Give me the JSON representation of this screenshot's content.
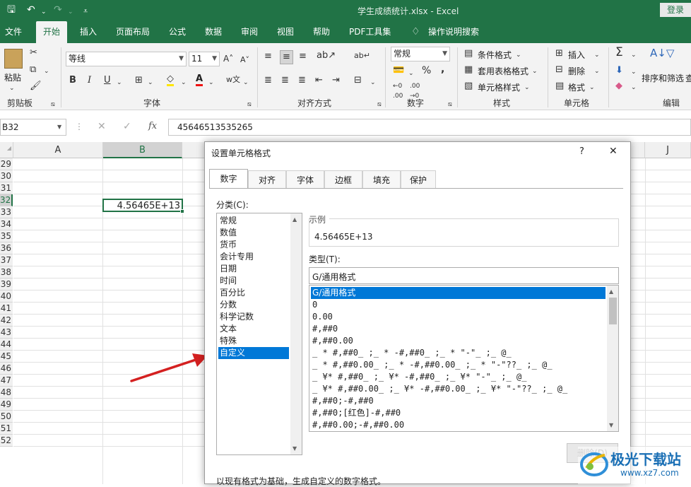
{
  "titlebar": {
    "doc_title": "学生成绩统计.xlsx  -  Excel",
    "login": "登录"
  },
  "tabs": [
    "文件",
    "开始",
    "插入",
    "页面布局",
    "公式",
    "数据",
    "审阅",
    "视图",
    "帮助",
    "PDF工具集",
    "操作说明搜索"
  ],
  "ribbon": {
    "clipboard": {
      "paste": "粘贴",
      "label": "剪贴板"
    },
    "font": {
      "name": "等线",
      "size": "11",
      "label": "字体",
      "bold": "B",
      "italic": "I",
      "underline": "U"
    },
    "align": {
      "label": "对齐方式"
    },
    "number": {
      "format": "常规",
      "label": "数字",
      "percent": "%",
      "comma": ","
    },
    "styles": {
      "conditional": "条件格式",
      "table": "套用表格格式",
      "cell": "单元格样式",
      "label": "样式"
    },
    "cells": {
      "insert": "插入",
      "delete": "删除",
      "format": "格式",
      "label": "单元格"
    },
    "edit": {
      "sort": "排序和筛选",
      "find": "查",
      "label": "编辑"
    }
  },
  "formula_bar": {
    "name_box": "B32",
    "fx": "fx",
    "value": "45646513535265"
  },
  "sheet": {
    "columns": [
      "A",
      "B",
      "J"
    ],
    "rows": [
      "29",
      "30",
      "31",
      "32",
      "33",
      "34",
      "35",
      "36",
      "37",
      "38",
      "39",
      "40",
      "41",
      "42",
      "43",
      "44",
      "45",
      "46",
      "47",
      "48",
      "49",
      "50",
      "51",
      "52"
    ],
    "active_cell_value": "4.56465E+13"
  },
  "dialog": {
    "title": "设置单元格格式",
    "help": "?",
    "close": "✕",
    "tabs": [
      "数字",
      "对齐",
      "字体",
      "边框",
      "填充",
      "保护"
    ],
    "category_label": "分类(C):",
    "categories": [
      "常规",
      "数值",
      "货币",
      "会计专用",
      "日期",
      "时间",
      "百分比",
      "分数",
      "科学记数",
      "文本",
      "特殊",
      "自定义"
    ],
    "sample_label": "示例",
    "sample_value": "4.56465E+13",
    "type_label": "类型(T):",
    "type_value": "G/通用格式",
    "types": [
      "G/通用格式",
      "0",
      "0.00",
      "#,##0",
      "#,##0.00",
      "_ * #,##0_ ;_ * -#,##0_ ;_ * \"-\"_ ;_ @_",
      "_ * #,##0.00_ ;_ * -#,##0.00_ ;_ * \"-\"??_ ;_ @_",
      "_ ¥* #,##0_ ;_ ¥* -#,##0_ ;_ ¥* \"-\"_ ;_ @_",
      "_ ¥* #,##0.00_ ;_ ¥* -#,##0.00_ ;_ ¥* \"-\"??_ ;_ @_",
      "#,##0;-#,##0",
      "#,##0;[红色]-#,##0",
      "#,##0.00;-#,##0.00"
    ],
    "delete_button": "删除(D)",
    "description": "以现有格式为基础，生成自定义的数字格式。"
  },
  "watermark": {
    "brand": "极光下载站",
    "url": "www.xz7.com"
  },
  "colors": {
    "excel_green": "#217346",
    "selection_blue": "#0078d7",
    "arrow_red": "#d42020"
  }
}
